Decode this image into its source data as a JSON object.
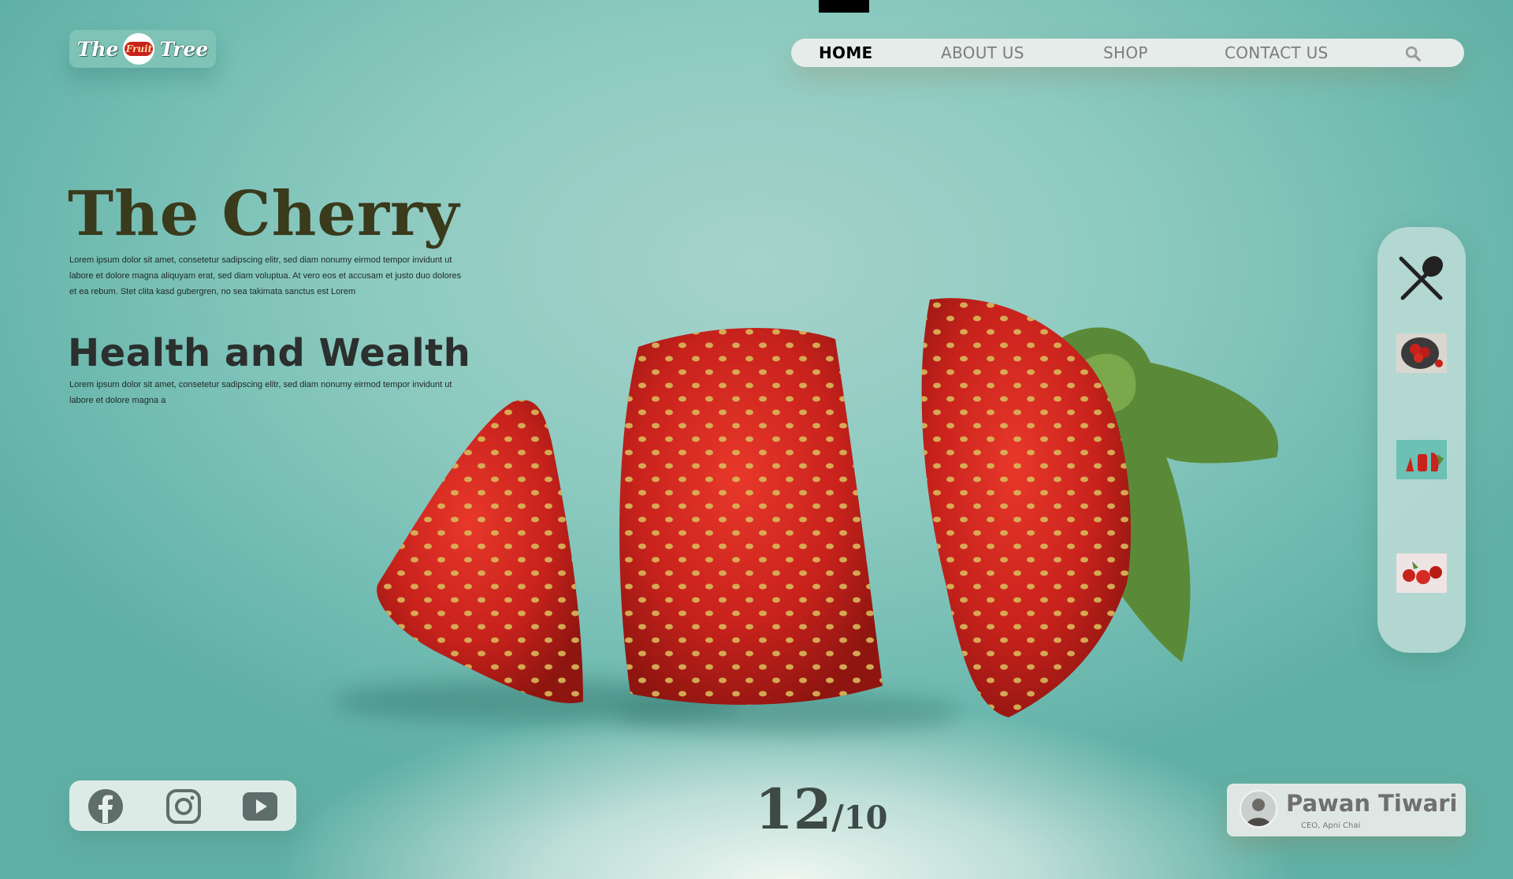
{
  "brand": {
    "logo_left": "The",
    "logo_center": "Fruit",
    "logo_right": "Tree"
  },
  "nav": {
    "items": [
      {
        "label": "HOME",
        "active": true
      },
      {
        "label": "ABOUT US",
        "active": false
      },
      {
        "label": "SHOP",
        "active": false
      },
      {
        "label": "CONTACT US",
        "active": false
      }
    ],
    "search_icon": "search-icon"
  },
  "hero": {
    "title": "The Cherry",
    "title_text": "Lorem ipsum dolor sit amet, consetetur sadipscing elitr, sed diam nonumy eirmod tempor invidunt ut labore et dolore magna aliquyam erat, sed diam voluptua. At vero eos et accusam et justo duo dolores et ea rebum. Stet clita kasd gubergren, no sea takimata sanctus est Lorem",
    "subtitle": "Health and Wealth",
    "subtitle_text": "Lorem ipsum dolor sit amet, consetetur sadipscing elitr, sed diam nonumy eirmod tempor invidunt ut labore et dolore magna a"
  },
  "sidebar": {
    "top_icon": "spoon-fork-icon",
    "thumbnails": [
      "strawberry-bowl-thumbnail",
      "sliced-strawberry-thumbnail",
      "strawberries-in-hand-thumbnail"
    ]
  },
  "social": {
    "icons": [
      "facebook-icon",
      "instagram-icon",
      "youtube-icon"
    ]
  },
  "counter": {
    "current": "12",
    "separator": "/",
    "total": "10"
  },
  "profile": {
    "name": "Pawan Tiwari",
    "role": "CEO, Apni Chai"
  },
  "colors": {
    "background": "#8ccac0",
    "title": "#3a3a1c",
    "strawberry": "#c8221c"
  }
}
